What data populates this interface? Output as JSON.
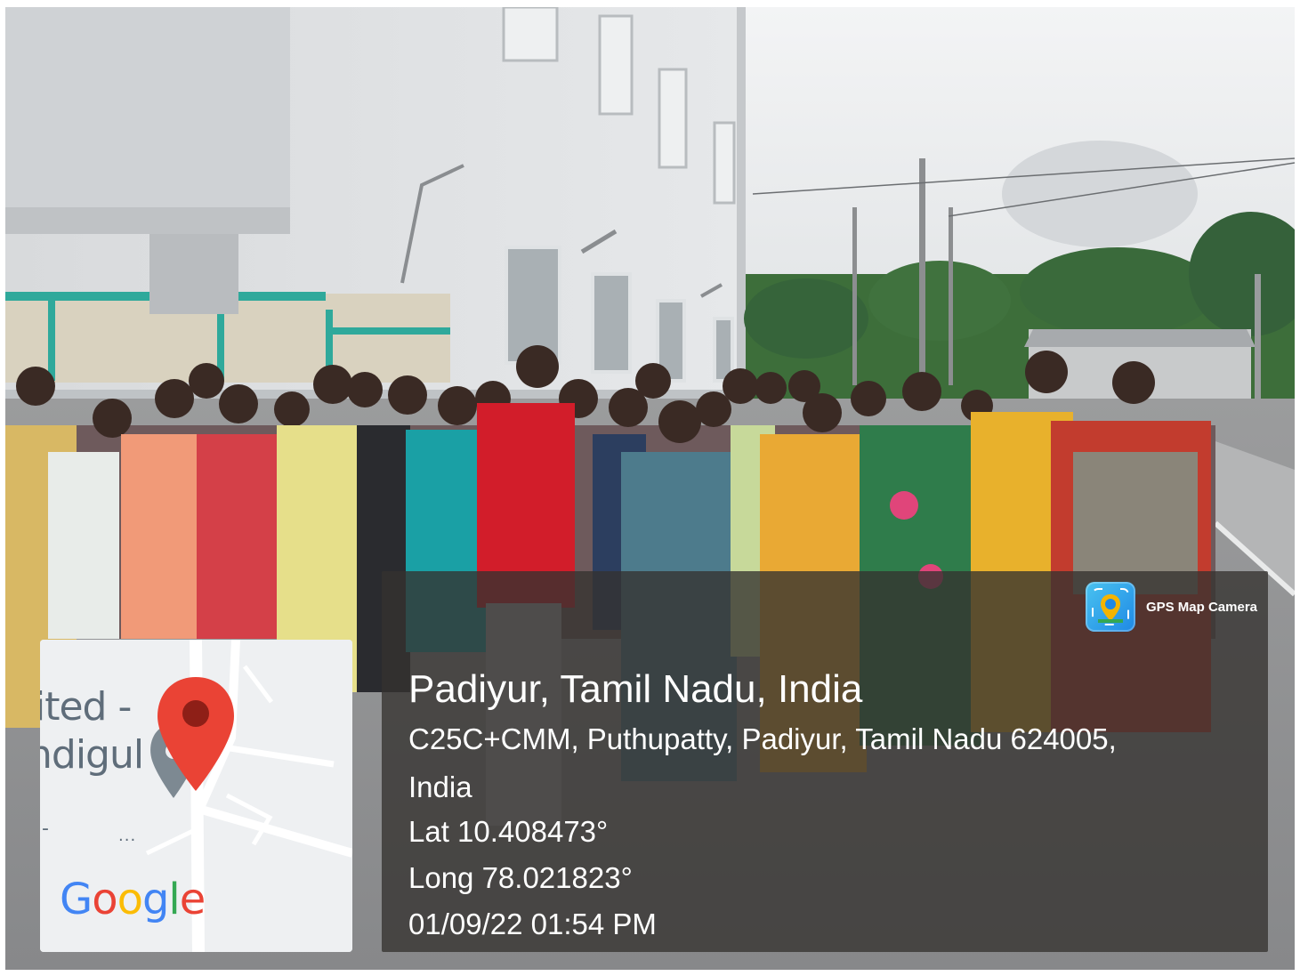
{
  "photo": {
    "description_tokens": [
      "group-photo",
      "building",
      "road",
      "palm-trees",
      "utility-pole"
    ]
  },
  "map_thumbnail": {
    "label_line_1": "ited -",
    "label_line_2": "ndigul",
    "ellipsis": "...",
    "dash": "-",
    "logo_text": "Google",
    "logo_colors": [
      "#4285F4",
      "#EA4335",
      "#FBBC05",
      "#4285F4",
      "#34A853",
      "#EA4335"
    ],
    "pin_color": "#EA4335",
    "pin_icon": "map-pin-icon"
  },
  "overlay": {
    "brand_icon": "gps-map-camera-icon",
    "brand_label": "GPS Map Camera",
    "title": "Padiyur, Tamil Nadu, India",
    "address_line_1": "C25C+CMM, Puthupatty, Padiyur, Tamil Nadu 624005,",
    "address_line_2": "India",
    "latitude": "Lat 10.408473°",
    "longitude": "Long 78.021823°",
    "timestamp": "01/09/22 01:54 PM",
    "panel_color": "#343230"
  }
}
